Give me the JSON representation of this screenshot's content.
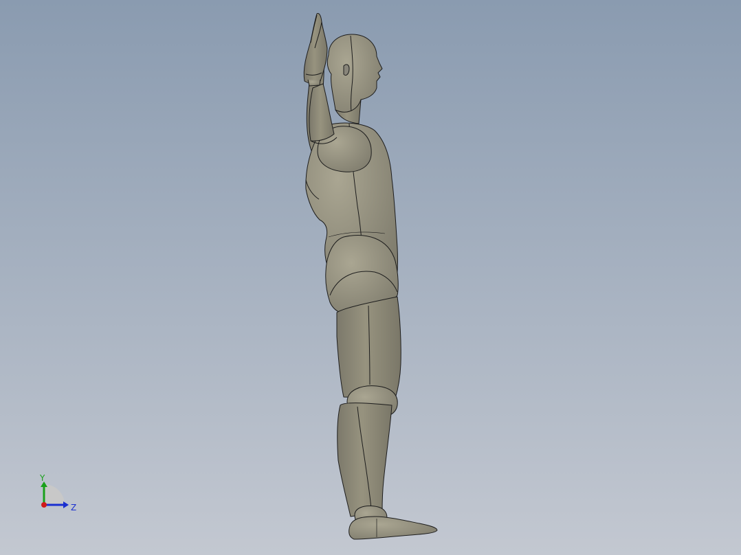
{
  "viewport": {
    "background_top": "#8a9bb0",
    "background_bottom": "#c3c8d1",
    "model_fill": "#8e8b7c",
    "edge_color": "#1c1c1c"
  },
  "triad": {
    "y_label": "Y",
    "z_label": "Z",
    "y_color": "#1aa01a",
    "z_color": "#1a2fd0",
    "x_color": "#d01a1a",
    "arc_color": "#c8c8c8"
  }
}
